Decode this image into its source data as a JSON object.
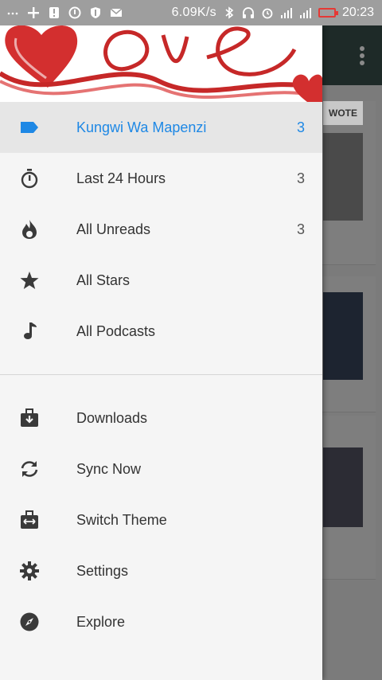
{
  "status_bar": {
    "speed": "6.09K/s",
    "time": "20:23"
  },
  "drawer": {
    "feeds": [
      {
        "label": "Kungwi Wa Mapenzi",
        "count": "3",
        "icon": "label-tag-icon"
      },
      {
        "label": "Last 24 Hours",
        "count": "3",
        "icon": "stopwatch-icon"
      },
      {
        "label": "All Unreads",
        "count": "3",
        "icon": "flame-icon"
      },
      {
        "label": "All Stars",
        "count": "",
        "icon": "star-icon"
      },
      {
        "label": "All Podcasts",
        "count": "",
        "icon": "music-note-icon"
      }
    ],
    "actions": [
      {
        "label": "Downloads",
        "icon": "download-case-icon"
      },
      {
        "label": "Sync Now",
        "icon": "sync-icon"
      },
      {
        "label": "Switch Theme",
        "icon": "switch-theme-icon"
      },
      {
        "label": "Settings",
        "icon": "gear-icon"
      },
      {
        "label": "Explore",
        "icon": "compass-icon"
      }
    ]
  },
  "background": {
    "card_banner": "WOTE"
  },
  "colors": {
    "accent": "#1e88e5",
    "heart": "#d32f2f"
  }
}
